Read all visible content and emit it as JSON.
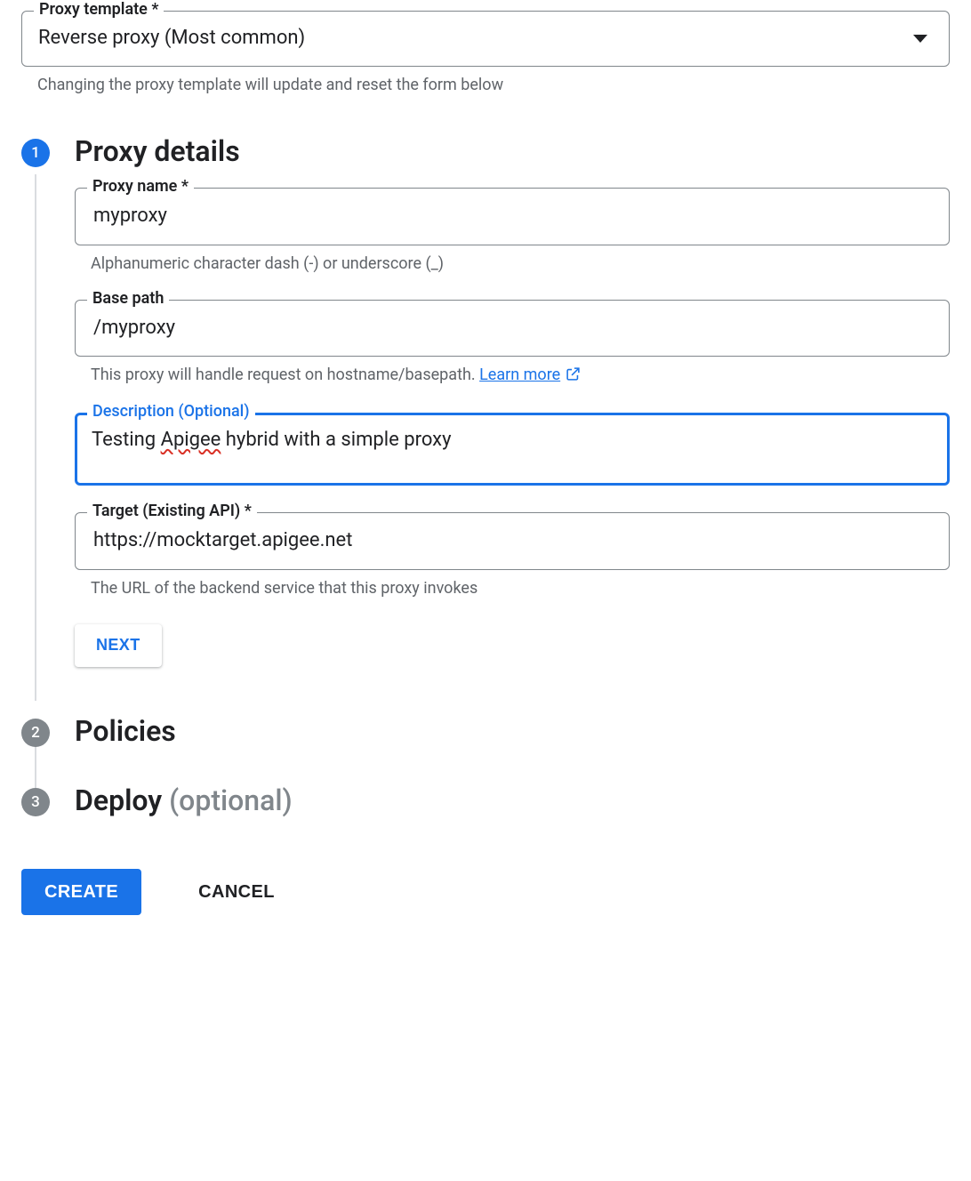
{
  "template": {
    "label": "Proxy template *",
    "value": "Reverse proxy (Most common)",
    "helper": "Changing the proxy template will update and reset the form below"
  },
  "steps": {
    "details": {
      "num": "1",
      "title": "Proxy details",
      "proxy_name": {
        "label": "Proxy name *",
        "value": "myproxy",
        "helper": "Alphanumeric character dash (-) or underscore (_)"
      },
      "base_path": {
        "label": "Base path",
        "value": "/myproxy",
        "helper_prefix": "This proxy will handle request on hostname/basepath. ",
        "helper_link": "Learn more"
      },
      "description": {
        "label": "Description (Optional)",
        "value_prefix": "Testing ",
        "value_spell": "Apigee",
        "value_suffix": " hybrid with a simple proxy"
      },
      "target": {
        "label": "Target (Existing API) *",
        "value": "https://mocktarget.apigee.net",
        "helper": "The URL of the backend service that this proxy invokes"
      },
      "next_label": "Next"
    },
    "policies": {
      "num": "2",
      "title": "Policies"
    },
    "deploy": {
      "num": "3",
      "title_main": "Deploy ",
      "title_optional": "(optional)"
    }
  },
  "actions": {
    "create": "Create",
    "cancel": "Cancel"
  }
}
